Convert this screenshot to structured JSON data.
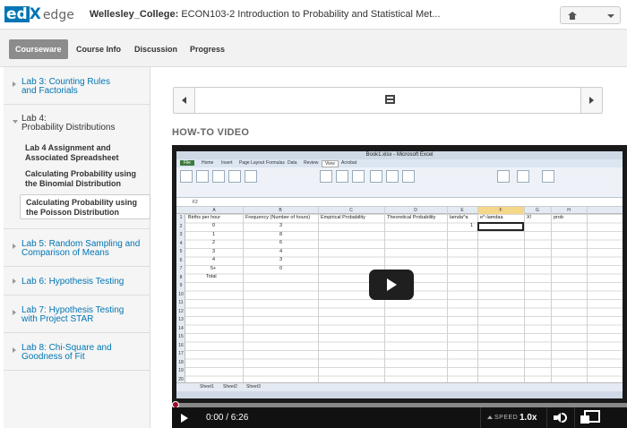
{
  "header": {
    "logo_ed": "ed",
    "logo_x": "X",
    "logo_edge": "edge",
    "org": "Wellesley_College:",
    "course": "ECON103-2 Introduction to Probability and Statistical Met..."
  },
  "nav": {
    "tabs": [
      {
        "label": "Courseware",
        "active": true
      },
      {
        "label": "Course Info"
      },
      {
        "label": "Discussion"
      },
      {
        "label": "Progress"
      }
    ]
  },
  "sidebar": {
    "chapters": [
      {
        "line1": "Lab 3: Counting Rules",
        "line2": "and Factorials"
      },
      {
        "line1": "Lab 4:",
        "line2": "Probability Distributions",
        "open": true
      },
      {
        "line1": "Lab 5: Random Sampling and",
        "line2": "Comparison of Means"
      },
      {
        "line1": "Lab 6: Hypothesis Testing",
        "line2": ""
      },
      {
        "line1": "Lab 7: Hypothesis Testing",
        "line2": "with Project STAR"
      },
      {
        "line1": "Lab 8: Chi-Square and",
        "line2": "Goodness of Fit"
      }
    ],
    "sections": [
      {
        "line1": "Lab 4 Assignment and",
        "line2": "Associated Spreadsheet"
      },
      {
        "line1": "Calculating Probability using",
        "line2": "the Binomial Distribution"
      },
      {
        "line1": "Calculating Probability using",
        "line2": "the Poisson Distribution",
        "active": true
      }
    ]
  },
  "main": {
    "video_heading": "HOW-TO VIDEO"
  },
  "video": {
    "time": "0:00 / 6:26",
    "speed_label": "SPEED",
    "speed_value": "1.0x",
    "progress": 0
  },
  "spreadsheet": {
    "title": "Book1.xlsx - Microsoft Excel",
    "ribbon_tabs": [
      "File",
      "Home",
      "Insert",
      "Page Layout",
      "Formulas",
      "Data",
      "Review",
      "View",
      "Acrobat"
    ],
    "name_box": "F2",
    "columns": [
      "A",
      "B",
      "C",
      "D",
      "E",
      "F",
      "G",
      "H"
    ],
    "headers": [
      "Births per hour",
      "Frequency (Number of hours)",
      "Empirical Probability",
      "Theoretical Probability",
      "lamda^a",
      "e^-lamdaa",
      "X!",
      "prob"
    ],
    "rows": [
      [
        "0",
        "3"
      ],
      [
        "1",
        "8"
      ],
      [
        "2",
        "6"
      ],
      [
        "3",
        "4"
      ],
      [
        "4",
        "3"
      ],
      [
        "5+",
        "0"
      ],
      [
        "Total",
        ""
      ]
    ],
    "e2_value": "1",
    "sheet_tabs": [
      "Sheet1",
      "Sheet2",
      "Sheet3"
    ]
  }
}
